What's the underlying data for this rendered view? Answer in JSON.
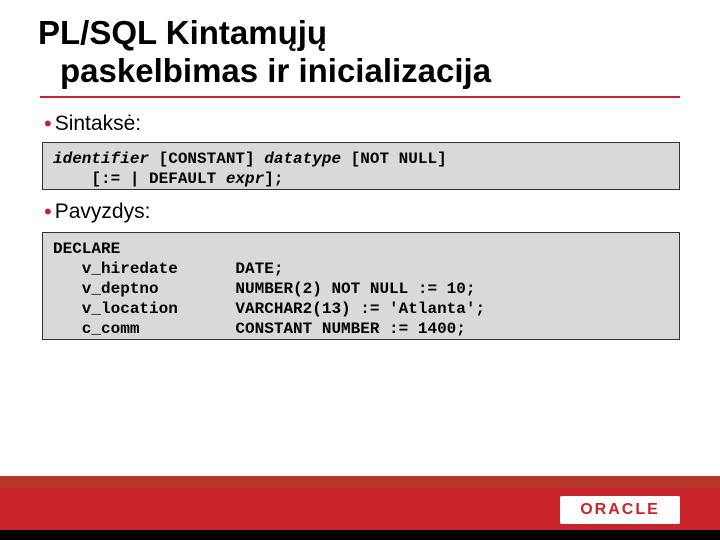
{
  "title": {
    "line1": "PL/SQL Kintamųjų",
    "line2": "paskelbimas ir inicializacija"
  },
  "bullets": {
    "syntax_label": "Sintaksė:",
    "example_label": "Pavyzdys:"
  },
  "code": {
    "syntax": {
      "seg1": "identifier",
      "seg2": " [CONSTANT] ",
      "seg3": "datatype",
      "seg4": " [NOT NULL]",
      "line2a": "    [:= | DEFAULT ",
      "seg5": "expr",
      "line2b": "];"
    },
    "example": "DECLARE\n   v_hiredate      DATE;\n   v_deptno        NUMBER(2) NOT NULL := 10;\n   v_location      VARCHAR2(13) := 'Atlanta';\n   c_comm          CONSTANT NUMBER := 1400;"
  },
  "logo_text": "ORACLE"
}
